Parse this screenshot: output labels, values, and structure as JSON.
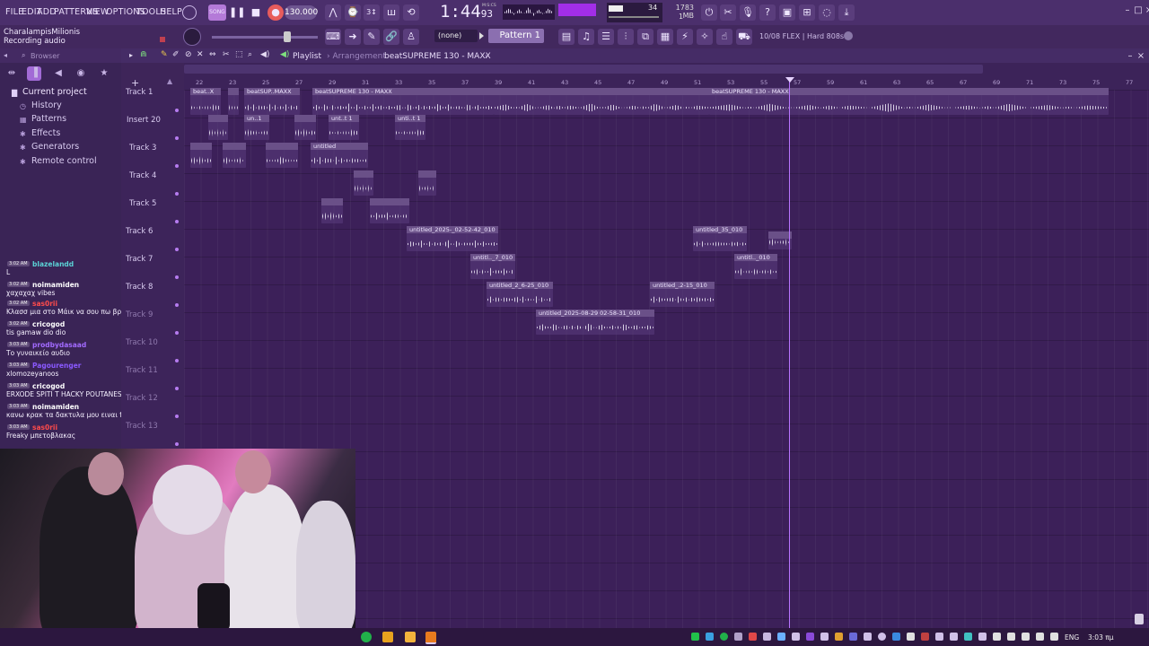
{
  "menu": [
    "FILE",
    "EDIT",
    "ADD",
    "PATTERNS",
    "VIEW",
    "OPTIONS",
    "TOOLS",
    "HELP"
  ],
  "transport": {
    "tempo": "130.000",
    "time_main": "1:44",
    "time_sub": "93",
    "time_unit": "M:S:CS"
  },
  "monitor": {
    "cpu": "34",
    "memory": "1783 MB",
    "polyphony": "1"
  },
  "user": {
    "name": "CharalampisMilionis",
    "status": "Recording audio"
  },
  "toolbar2": {
    "snap": "(none)",
    "pattern": "Pattern 1",
    "flex_info": "10/08  FLEX | Hard 808s"
  },
  "browser": {
    "title": "Browser",
    "items": [
      "Current project",
      "History",
      "Patterns",
      "Effects",
      "Generators",
      "Remote control"
    ]
  },
  "chat": [
    {
      "time": "3:02 AM",
      "user": "blazelandd",
      "color": "#5bd3d6",
      "msg": "L"
    },
    {
      "time": "3:02 AM",
      "user": "noimamiden",
      "color": "#ffffff",
      "msg": "χαχαχαχ vibes"
    },
    {
      "time": "3:02 AM",
      "user": "sas0rii",
      "color": "#ff4b4b",
      "msg": "Κλασσ μια στο Μάικ να σου πω βρες μουσικ διαφορές"
    },
    {
      "time": "3:02 AM",
      "user": "cricogod",
      "color": "#ffffff",
      "msg": "tis gamaw dio dio"
    },
    {
      "time": "3:03 AM",
      "user": "prodbydasaad",
      "color": "#a26bff",
      "msg": "Το γυναικείο αυδιο"
    },
    {
      "time": "3:03 AM",
      "user": "Pagourenger",
      "color": "#8a59ff",
      "msg": "xlomozeyanoos"
    },
    {
      "time": "3:03 AM",
      "user": "cricogod",
      "color": "#ffffff",
      "msg": "ERXODE SPITI T HACKY POUTANES TIS GAMAW DIODIO"
    },
    {
      "time": "3:03 AM",
      "user": "noimamiden",
      "color": "#ffffff",
      "msg": "κανω κρακ τα δακτυλα μου ειναι freaky dio"
    },
    {
      "time": "3:03 AM",
      "user": "sas0rii",
      "color": "#ff4b4b",
      "msg": "Freaky μπετοβλακας"
    }
  ],
  "playlist": {
    "title": "Playlist",
    "subtitle": "Arrangement",
    "song": "beatSUPREME 130 - MAXX",
    "ruler": [
      "22",
      "23",
      "25",
      "27",
      "29",
      "31",
      "33",
      "35",
      "37",
      "39",
      "41",
      "43",
      "45",
      "47",
      "49",
      "51",
      "53",
      "55",
      "57",
      "59",
      "61",
      "63",
      "65",
      "67",
      "69",
      "71",
      "73",
      "75",
      "77"
    ],
    "tracks": [
      "Track 1",
      "Insert 20",
      "Track 3",
      "Track 4",
      "Track 5",
      "Track 6",
      "Track 7",
      "Track 8",
      "Track 9",
      "Track 10",
      "Track 11",
      "Track 12",
      "Track 13"
    ]
  },
  "clips": [
    {
      "label": "beat..X"
    },
    {
      "label": "beatSUP..MAXX"
    },
    {
      "label": "beatSUPREME 130 - MAXX"
    },
    {
      "label": "beatSUPREME 130 - MAXX"
    },
    {
      "label": "un..1"
    },
    {
      "label": "unt..t 1"
    },
    {
      "label": "unti..t 1"
    },
    {
      "label": "untitled"
    },
    {
      "label": "untitled_2025-_02-52-42_010"
    },
    {
      "label": "untitled_35_010"
    },
    {
      "label": "untitl.._7_010"
    },
    {
      "label": "untitl.._010"
    },
    {
      "label": "untitled_2_6-25_010"
    },
    {
      "label": "untitled_.2-15_010"
    },
    {
      "label": "untitled_2025-08-29 02-58-31_010"
    }
  ],
  "taskbar": {
    "lang": "ENG",
    "time": "3:03 πμ"
  }
}
